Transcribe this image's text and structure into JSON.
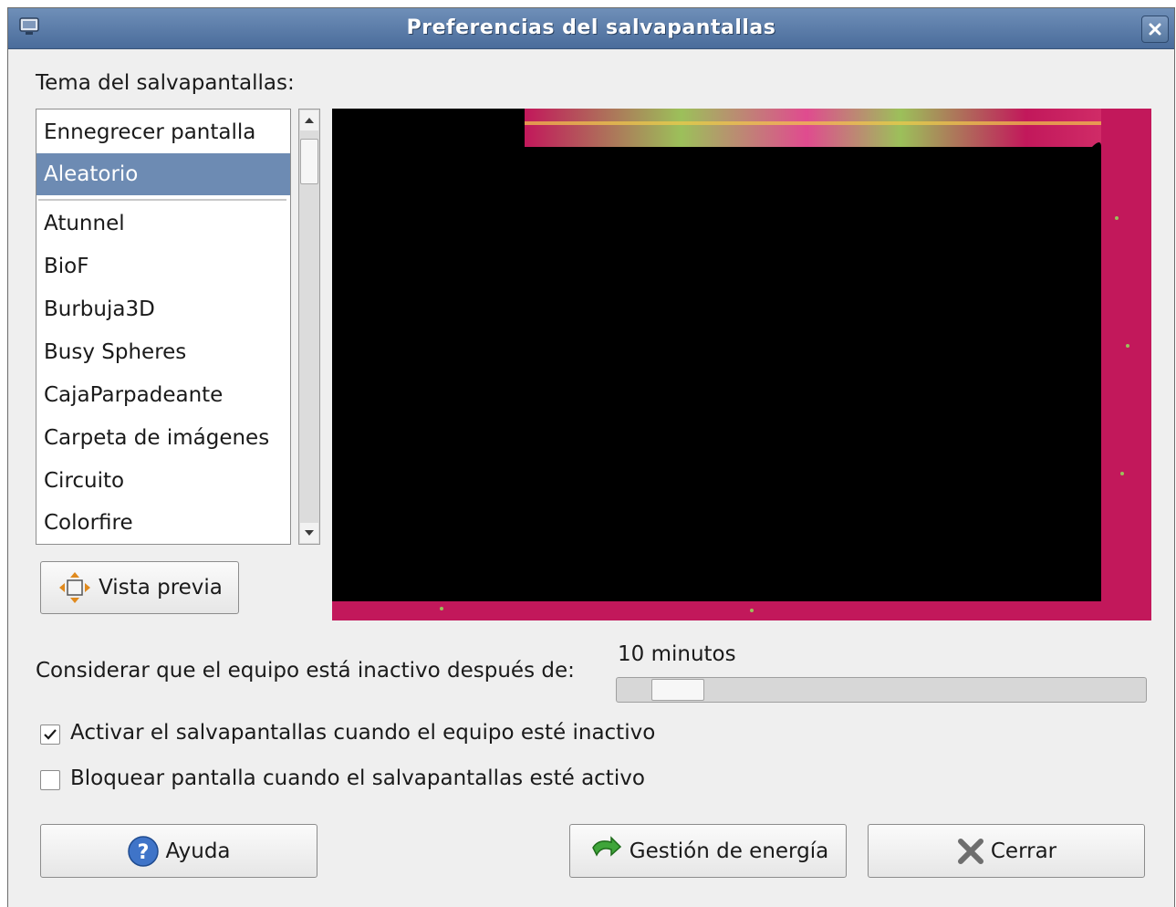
{
  "window": {
    "title": "Preferencias del salvapantallas"
  },
  "theme_label": "Tema del salvapantallas:",
  "theme_list": {
    "items": [
      "Ennegrecer pantalla",
      "Aleatorio",
      "Atunnel",
      "BioF",
      "Burbuja3D",
      "Busy Spheres",
      "CajaParpadeante",
      "Carpeta de imágenes",
      "Circuito",
      "Colorfire"
    ],
    "selected": "Aleatorio"
  },
  "preview_button": {
    "label": "Vista previa"
  },
  "idle": {
    "label": "Considerar que el equipo está inactivo después de:",
    "value": "10 minutos"
  },
  "checkboxes": {
    "activate": {
      "label": "Activar el salvapantallas cuando el equipo esté inactivo",
      "checked": true
    },
    "lock": {
      "label": "Bloquear pantalla cuando el salvapantallas esté activo",
      "checked": false
    }
  },
  "buttons": {
    "help": "Ayuda",
    "power": "Gestión de energía",
    "close": "Cerrar"
  },
  "colors": {
    "titlebar": "#5a7aa6",
    "selection": "#6d8bb3",
    "preview_magenta": "#c2185b",
    "preview_green": "#9cc05a"
  },
  "icons": [
    "monitor-icon",
    "close-icon",
    "arrow-up-icon",
    "arrow-down-icon",
    "move-icon",
    "help-icon",
    "refresh-arrow-icon",
    "x-cross-icon",
    "checkmark-icon"
  ]
}
